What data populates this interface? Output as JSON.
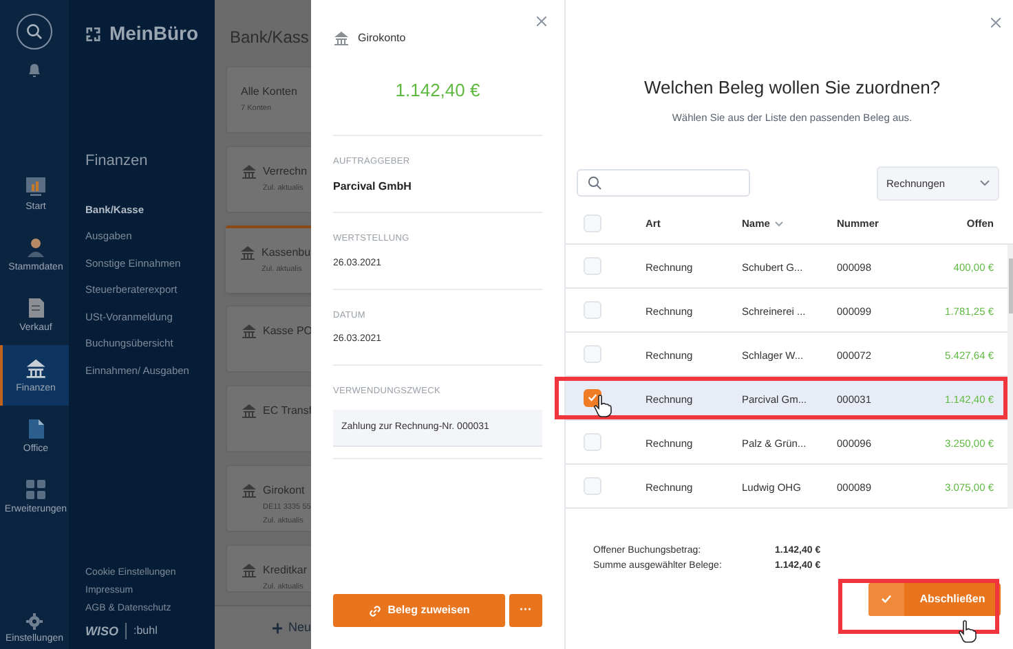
{
  "rail": {
    "items": [
      {
        "label": "Start",
        "selected": false
      },
      {
        "label": "Stammdaten",
        "selected": false
      },
      {
        "label": "Verkauf",
        "selected": false
      },
      {
        "label": "Finanzen",
        "selected": true
      },
      {
        "label": "Office",
        "selected": false
      },
      {
        "label": "Erweiterungen",
        "selected": false
      }
    ],
    "settings": "Einstellungen"
  },
  "nav": {
    "logo": "MeinBüro",
    "section": "Finanzen",
    "items": [
      {
        "label": "Bank/Kasse",
        "selected": true
      },
      {
        "label": "Ausgaben",
        "selected": false
      },
      {
        "label": "Sonstige Einnahmen",
        "selected": false
      },
      {
        "label": "Steuerberaterexport",
        "selected": false
      },
      {
        "label": "USt-Voranmeldung",
        "selected": false
      },
      {
        "label": "Buchungsübersicht",
        "selected": false
      },
      {
        "label": "Einnahmen/ Ausgaben",
        "selected": false
      }
    ],
    "footer_links": [
      "Cookie Einstellungen",
      "Impressum",
      "AGB & Datenschutz"
    ],
    "brand_left": "WISO",
    "brand_right": ":buhl"
  },
  "content": {
    "title": "Bank/Kass",
    "accounts": [
      {
        "name": "Alle Konten",
        "lines": [
          "7 Konten"
        ],
        "bank_icon": false,
        "selected": false
      },
      {
        "name": "Verrechn",
        "lines": [
          "Zul. aktualis"
        ],
        "bank_icon": true,
        "selected": false
      },
      {
        "name": "Kassenbu",
        "lines": [
          "Zul. aktualis"
        ],
        "bank_icon": true,
        "selected": true
      },
      {
        "name": "Kasse PO",
        "bank_icon": true,
        "selected": false
      },
      {
        "name": "EC Transf",
        "bank_icon": true,
        "selected": false
      },
      {
        "name": "Girokont",
        "lines": [
          "DE11 3335 55",
          "Zul. aktualis"
        ],
        "bank_icon": true,
        "selected": false
      },
      {
        "name": "Kreditkar",
        "lines": [
          "Zul. aktualis"
        ],
        "bank_icon": true,
        "selected": false
      }
    ],
    "new_button": "Neu"
  },
  "detail": {
    "account": "Girokonto",
    "amount": "1.142,40 €",
    "fields": [
      {
        "label": "AUFTRAGGEBER",
        "value": "Parcival GmbH",
        "kind": "bold"
      },
      {
        "label": "WERTSTELLUNG",
        "value": "26.03.2021",
        "kind": "plain"
      },
      {
        "label": "DATUM",
        "value": "26.03.2021",
        "kind": "plain"
      },
      {
        "label": "VERWENDUNGSZWECK",
        "value": "Zahlung zur Rechnung-Nr. 000031",
        "kind": "boxed"
      }
    ],
    "assign_button": "Beleg zuweisen",
    "more_button": "···"
  },
  "dialog": {
    "title": "Welchen Beleg wollen Sie zuordnen?",
    "subtitle": "Wählen Sie aus der Liste den passenden Beleg aus.",
    "filter": "Rechnungen",
    "all_checked": false,
    "columns": [
      "Art",
      "Name",
      "Nummer",
      "Offen"
    ],
    "rows": [
      {
        "art": "Rechnung",
        "name": "Schubert G...",
        "nummer": "000098",
        "offen": "400,00 €",
        "checked": false,
        "selected": false
      },
      {
        "art": "Rechnung",
        "name": "Schreinerei ...",
        "nummer": "000099",
        "offen": "1.781,25 €",
        "checked": false,
        "selected": false
      },
      {
        "art": "Rechnung",
        "name": "Schlager W...",
        "nummer": "000072",
        "offen": "5.427,64 €",
        "checked": false,
        "selected": false
      },
      {
        "art": "Rechnung",
        "name": "Parcival Gm...",
        "nummer": "000031",
        "offen": "1.142,40 €",
        "checked": true,
        "selected": true
      },
      {
        "art": "Rechnung",
        "name": "Palz & Grün...",
        "nummer": "000096",
        "offen": "3.250,00 €",
        "checked": false,
        "selected": false
      },
      {
        "art": "Rechnung",
        "name": "Ludwig OHG",
        "nummer": "000089",
        "offen": "3.075,00 €",
        "checked": false,
        "selected": false
      }
    ],
    "summary": [
      {
        "label": "Offener Buchungsbetrag:",
        "value": "1.142,40 €"
      },
      {
        "label": "Summe ausgewählter Belege:",
        "value": "1.142,40 €"
      }
    ],
    "finish_button": "Abschließen"
  }
}
